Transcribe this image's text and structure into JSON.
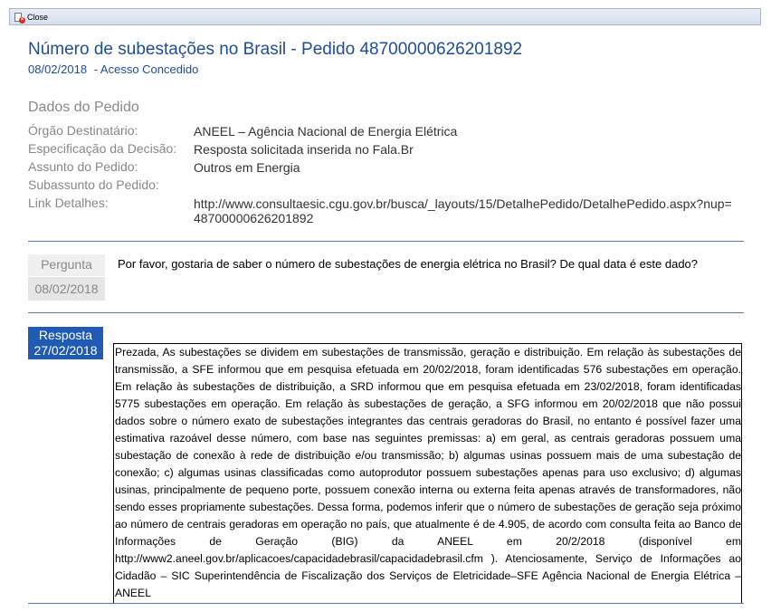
{
  "toolbar": {
    "close_label": "Close"
  },
  "header": {
    "title": "Número de subestações no Brasil - Pedido 48700000626201892",
    "date": "08/02/2018",
    "status": "- Acesso Concedido"
  },
  "details": {
    "heading": "Dados do Pedido",
    "fields": [
      {
        "label": "Órgão Destinatário:",
        "value": "ANEEL – Agência Nacional de Energia Elétrica"
      },
      {
        "label": "Especificação da Decisão:",
        "value": "Resposta solicitada inserida no Fala.Br"
      },
      {
        "label": "Assunto do Pedido:",
        "value": "Outros em Energia"
      },
      {
        "label": "Subassunto do Pedido:",
        "value": ""
      },
      {
        "label": "Link Detalhes:",
        "value": "http://www.consultaesic.cgu.gov.br/busca/_layouts/15/DetalhePedido/DetalhePedido.aspx?nup=48700000626201892"
      }
    ]
  },
  "question": {
    "label": "Pergunta",
    "date": "08/02/2018",
    "text": "Por favor, gostaria de saber o número de subestações de energia elétrica no Brasil? De qual data é este dado?"
  },
  "answer": {
    "label": "Resposta",
    "date": "27/02/2018",
    "text": "Prezada, As subestações se dividem em subestações de transmissão, geração e distribuição. Em relação às subestações de transmissão, a SFE informou que em pesquisa efetuada em 20/02/2018, foram identificadas 576 subestações em operação. Em relação às subestações de distribuição, a SRD informou que em pesquisa efetuada em 23/02/2018, foram identificadas 5775 subestações em operação. Em relação às subestações de geração, a SFG informou em 20/02/2018 que não possui dados sobre o número exato de subestações integrantes das centrais geradoras do Brasil, no entanto é possível fazer uma estimativa razoável desse número, com base nas seguintes premissas: a) em geral, as centrais geradoras possuem uma subestação de conexão à rede de distribuição e/ou transmissão; b) algumas usinas possuem mais de uma subestação de conexão; c) algumas usinas classificadas como autoprodutor possuem subestações apenas para uso exclusivo; d) algumas usinas, principalmente de pequeno porte, possuem conexão interna ou externa feita apenas através de transformadores, não sendo esses propriamente subestações. Dessa forma, podemos inferir que o número de subestações de geração seja próximo ao número de centrais geradoras em operação no país, que atualmente é de 4.905, de acordo com consulta feita ao Banco de Informações de Geração (BIG) da ANEEL em 20/2/2018 (disponível em http://www2.aneel.gov.br/aplicacoes/capacidadebrasil/capacidadebrasil.cfm ). Atenciosamente, Serviço de Informações ao Cidadão – SIC Superintendência de Fiscalização dos Serviços de Eletricidade–SFE Agência Nacional de Energia Elétrica – ANEEL"
  },
  "colors": {
    "title": "#1f4e96",
    "label_gray": "#888888",
    "answer_badge": "#1f5bb5",
    "divider": "#5b7bb0",
    "close_icon_red": "#d62b1f"
  },
  "icons": {
    "close": "close-icon"
  }
}
